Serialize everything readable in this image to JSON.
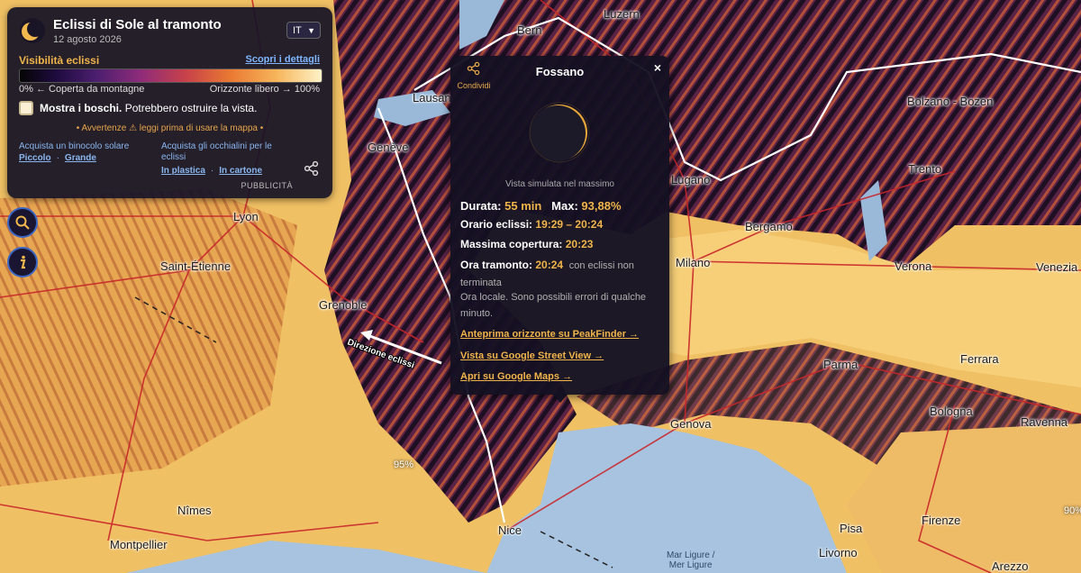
{
  "panel": {
    "title": "Eclissi di Sole al tramonto",
    "date": "12 agosto 2026",
    "language": "IT",
    "visibility_label": "Visibilità eclissi",
    "details_link": "Scopri i dettagli",
    "scale_left": "0% ← Coperta da montagne",
    "scale_right": "Orizzonte libero → 100%",
    "woods_bold": "Mostra i boschi.",
    "woods_rest": " Potrebbero ostruire la vista.",
    "woods_checked": false,
    "warning": "• Avvertenze ⚠ leggi prima di usare la mappa •",
    "binoculars_label": "Acquista un binocolo solare",
    "binoculars_small": "Piccolo",
    "binoculars_large": "Grande",
    "glasses_label": "Acquista gli occhialini per le eclissi",
    "glasses_plastic": "In plastica",
    "glasses_cardboard": "In cartone",
    "separator": "·",
    "ad_label": "PUBBLICITÀ"
  },
  "popup": {
    "share_label": "Condividi",
    "title": "Fossano",
    "close": "×",
    "simulated": "Vista simulata nel massimo",
    "duration_label": "Durata:",
    "duration_value": "55 min",
    "max_label": "Max:",
    "max_value": "93,88%",
    "times_label": "Orario eclissi:",
    "times_value": "19:29 – 20:24",
    "maxcov_label": "Massima copertura:",
    "maxcov_value": "20:23",
    "sunset_label": "Ora tramonto:",
    "sunset_value": "20:24",
    "sunset_note": "con eclissi non terminata",
    "local_note": "Ora locale. Sono possibili errori di qualche minuto.",
    "link_peakfinder": "Anteprima orizzonte su PeakFinder →",
    "link_streetview": "Vista su Google Street View →",
    "link_maps": "Apri su Google Maps →"
  },
  "map": {
    "direction_label": "Direzione eclissi",
    "sea_label_1": "Mar Ligure /",
    "sea_label_2": "Mer Ligure",
    "percent_95": "95%",
    "percent_90": "90%",
    "cities": {
      "bern": "Bern",
      "luzern": "Luzern",
      "lausanne": "Lausan",
      "geneve": "Genève",
      "lyon": "Lyon",
      "saint_etienne": "Saint-Étienne",
      "grenoble": "Grenoble",
      "nimes": "Nîmes",
      "montpellier": "Montpellier",
      "nice": "Nice",
      "lugano": "Lugano",
      "bergamo": "Bergamo",
      "milano": "Milano",
      "bolzano": "Bolzano - Bozen",
      "trento": "Trento",
      "verona": "Verona",
      "venezia": "Venezia",
      "parma": "Parma",
      "ferrara": "Ferrara",
      "bologna": "Bologna",
      "ravenna": "Ravenna",
      "genova": "Genova",
      "pisa": "Pisa",
      "livorno": "Livorno",
      "firenze": "Firenze",
      "arezzo": "Arezzo"
    }
  },
  "colors": {
    "accent": "#f0b44a",
    "link": "#89b6ee",
    "panel_bg": "#161226"
  }
}
